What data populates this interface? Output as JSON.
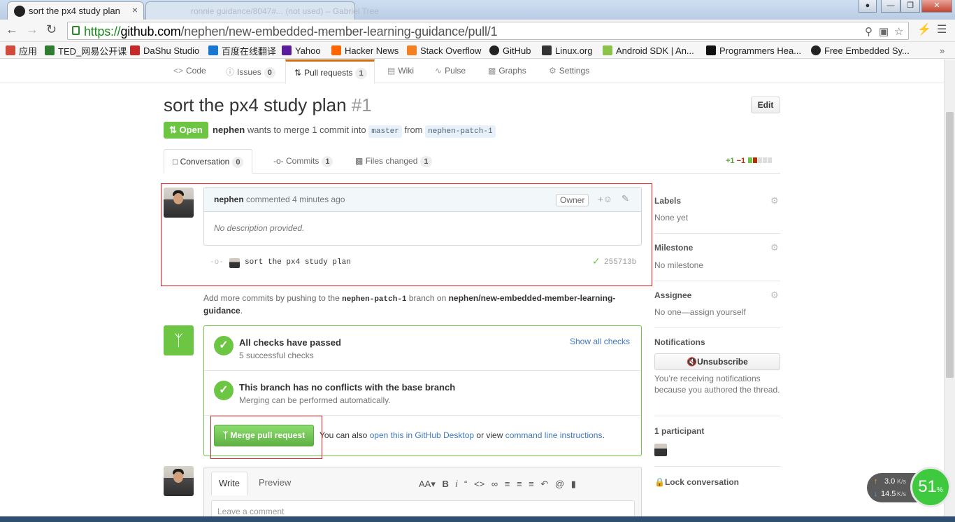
{
  "browser": {
    "active_tab_title": "sort the px4 study plan",
    "inactive_tab_title": "ronnie guidance/8047#... (not used) – Gabriel Tree",
    "close_glyph": "×",
    "url_scheme": "https://",
    "url_host": "github.com",
    "url_path": "/nephen/new-embedded-member-learning-guidance/pull/1",
    "bookmarks": [
      {
        "label": "应用",
        "icon": "apps-icon",
        "color": "#d24b3a"
      },
      {
        "label": "TED_网易公开课",
        "icon": "play-icon",
        "color": "#2e7d32"
      },
      {
        "label": "DaShu Studio",
        "icon": "dashu-icon",
        "color": "#c62828"
      },
      {
        "label": "百度在线翻译",
        "icon": "translate-icon",
        "color": "#1976d2"
      },
      {
        "label": "Yahoo",
        "icon": "yahoo-icon",
        "color": "#5c1a9e"
      },
      {
        "label": "Hacker News",
        "icon": "hn-icon",
        "color": "#ff6600"
      },
      {
        "label": "Stack Overflow",
        "icon": "stackoverflow-icon",
        "color": "#f48024"
      },
      {
        "label": "GitHub",
        "icon": "github-icon",
        "color": "#222222"
      },
      {
        "label": "Linux.org",
        "icon": "tux-icon",
        "color": "#333333"
      },
      {
        "label": "Android SDK | An...",
        "icon": "android-icon",
        "color": "#8bc34a"
      },
      {
        "label": "Programmers Hea...",
        "icon": "ph-icon",
        "color": "#111111"
      },
      {
        "label": "Free Embedded Sy...",
        "icon": "embedded-icon",
        "color": "#222222"
      }
    ],
    "bookmarks_overflow": "»"
  },
  "repo_nav": {
    "code": "Code",
    "issues": "Issues",
    "issues_count": "0",
    "pull_requests": "Pull requests",
    "pull_requests_count": "1",
    "wiki": "Wiki",
    "pulse": "Pulse",
    "graphs": "Graphs",
    "settings": "Settings"
  },
  "pr": {
    "title": "sort the px4 study plan",
    "number": "#1",
    "edit": "Edit",
    "state": "Open",
    "author": "nephen",
    "meta_mid": "wants to merge 1 commit into",
    "base": "master",
    "from": "from",
    "head": "nephen-patch-1"
  },
  "tabs": {
    "conversation": "Conversation",
    "conversation_count": "0",
    "commits": "Commits",
    "commits_count": "1",
    "files": "Files changed",
    "files_count": "1",
    "diff_add": "+1",
    "diff_del": "−1"
  },
  "comment": {
    "author": "nephen",
    "action": "commented",
    "time": "4 minutes ago",
    "role": "Owner",
    "body": "No description provided."
  },
  "commit": {
    "message": "sort the px4 study plan",
    "sha": "255713b"
  },
  "addmore": {
    "pre": "Add more commits by pushing to the",
    "branch": "nephen-patch-1",
    "mid": "branch on",
    "repo": "nephen/new-embedded-member-learning-guidance",
    "end": "."
  },
  "merge": {
    "checks_title": "All checks have passed",
    "checks_sub": "5 successful checks",
    "show_all": "Show all checks",
    "conflicts_title": "This branch has no conflicts with the base branch",
    "conflicts_sub": "Merging can be performed automatically.",
    "button": "Merge pull request",
    "alt_pre": "You can also",
    "alt_link1": "open this in GitHub Desktop",
    "alt_mid": "or view",
    "alt_link2": "command line instructions",
    "alt_end": "."
  },
  "write": {
    "write_tab": "Write",
    "preview_tab": "Preview",
    "placeholder": "Leave a comment"
  },
  "sidebar": {
    "labels_h": "Labels",
    "labels_v": "None yet",
    "milestone_h": "Milestone",
    "milestone_v": "No milestone",
    "assignee_h": "Assignee",
    "assignee_v": "No one—assign yourself",
    "notifications_h": "Notifications",
    "unsubscribe": "Unsubscribe",
    "notif_text": "You’re receiving notifications because you authored the thread.",
    "participants": "1 participant",
    "lock": "Lock conversation"
  },
  "net_widget": {
    "up": "3.0",
    "down": "14.5",
    "unit": "K/s",
    "percent": "51",
    "percent_sign": "%"
  },
  "colors": {
    "open_green": "#6cc644",
    "accent_orange": "#d26911",
    "link_blue": "#4078c0",
    "annotation_red": "#e02020"
  }
}
